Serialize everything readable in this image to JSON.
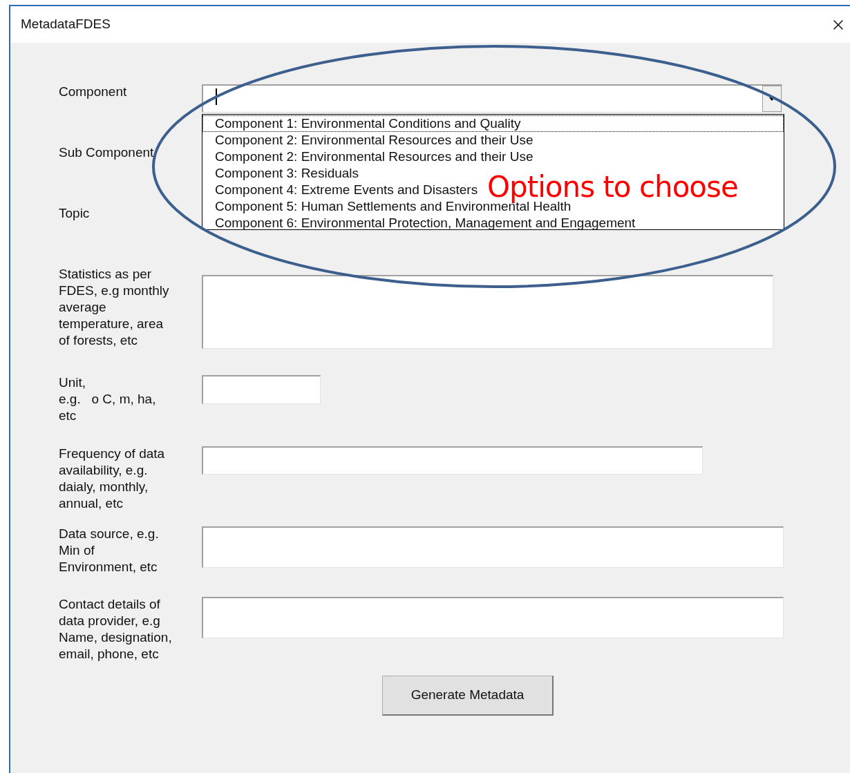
{
  "window": {
    "title": "MetadataFDES"
  },
  "fields": [
    {
      "label": "Component",
      "kind": "combo"
    },
    {
      "label": "Sub Component",
      "kind": "covered"
    },
    {
      "label": "Topic",
      "kind": "covered"
    },
    {
      "label": "Statistics as per FDES, e.g monthly average temperature, area of forests, etc",
      "kind": "box"
    },
    {
      "label": "Unit,\ne.g.   o C, m, ha, etc",
      "kind": "box"
    },
    {
      "label": "Frequency of data availability, e.g. daialy, monthly, annual, etc",
      "kind": "box"
    },
    {
      "label": "Data source, e.g. Min of Environment, etc",
      "kind": "box"
    },
    {
      "label": "Contact details of data provider, e.g Name, designation, email, phone, etc",
      "kind": "box"
    }
  ],
  "dropdown": {
    "items": [
      {
        "label": "Component 1: Environmental Conditions and Quality",
        "selected": true
      },
      {
        "label": "Component 2: Environmental Resources and their Use",
        "selected": false
      },
      {
        "label": "Component 2: Environmental Resources and their Use",
        "selected": false
      },
      {
        "label": "Component 3: Residuals",
        "selected": false
      },
      {
        "label": "Component 4: Extreme Events and Disasters",
        "selected": false
      },
      {
        "label": "Component 5: Human Settlements and Environmental Health",
        "selected": false
      },
      {
        "label": "Component 6: Environmental Protection, Management and Engagement",
        "selected": false
      }
    ]
  },
  "button": "Generate Metadata",
  "annotation": {
    "text": "Options to choose"
  }
}
